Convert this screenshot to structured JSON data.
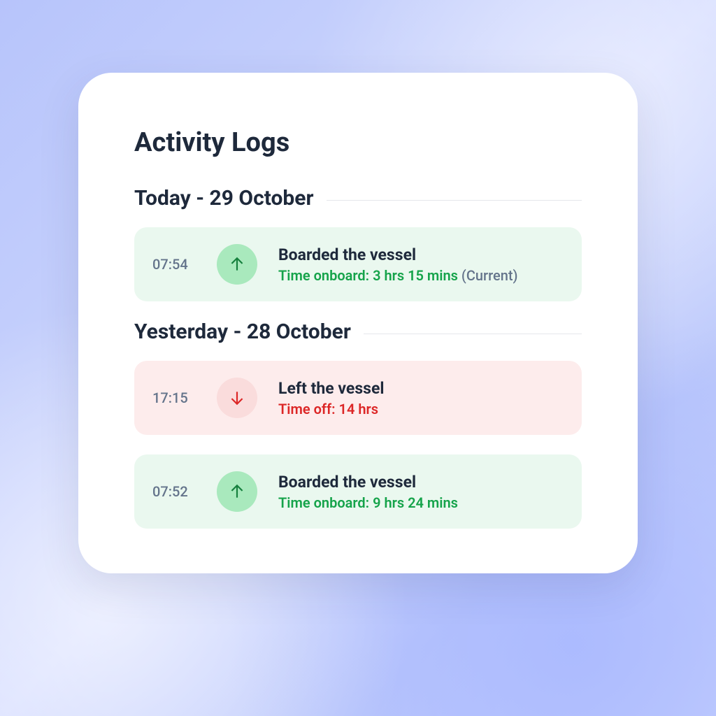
{
  "title": "Activity Logs",
  "sections": [
    {
      "heading": "Today - 29 October",
      "logs": [
        {
          "time": "07:54",
          "kind": "boarded",
          "headline": "Boarded the vessel",
          "subline": "Time onboard: 3 hrs 15 mins",
          "suffix": " (Current)"
        }
      ]
    },
    {
      "heading": "Yesterday - 28 October",
      "logs": [
        {
          "time": "17:15",
          "kind": "left",
          "headline": "Left the vessel",
          "subline": "Time off: 14 hrs",
          "suffix": ""
        },
        {
          "time": "07:52",
          "kind": "boarded",
          "headline": "Boarded the vessel",
          "subline": "Time onboard: 9 hrs 24 mins",
          "suffix": ""
        }
      ]
    }
  ]
}
